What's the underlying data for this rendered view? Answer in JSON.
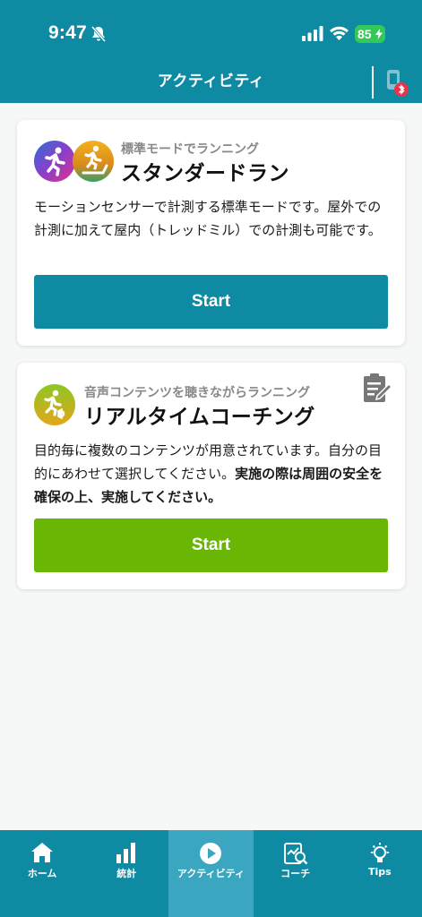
{
  "status": {
    "time": "9:47",
    "battery": "85"
  },
  "header": {
    "title": "アクティビティ"
  },
  "cards": {
    "standard": {
      "subtitle": "標準モードでランニング",
      "title": "スタンダードラン",
      "description": "モーションセンサーで計測する標準モードです。屋外での計測に加えて屋内（トレッドミル）での計測も可能です。",
      "start_label": "Start"
    },
    "coaching": {
      "subtitle": "音声コンテンツを聴きながらランニング",
      "title": "リアルタイムコーチング",
      "description": "目的毎に複数のコンテンツが用意されています。自分の目的にあわせて選択してください。",
      "description_bold": "実施の際は周囲の安全を確保の上、実施してください。",
      "start_label": "Start"
    }
  },
  "tabs": [
    {
      "label": "ホーム",
      "icon": "home-icon"
    },
    {
      "label": "統計",
      "icon": "stats-icon"
    },
    {
      "label": "アクティビティ",
      "icon": "play-icon",
      "active": true
    },
    {
      "label": "コーチ",
      "icon": "coach-icon"
    },
    {
      "label": "Tips",
      "icon": "lightbulb-icon"
    }
  ],
  "colors": {
    "primary": "#0f8aa3",
    "active_tab": "#3aa6bf",
    "coaching_green": "#6ab604",
    "battery_green": "#34c759",
    "alert_red": "#e8344c"
  }
}
